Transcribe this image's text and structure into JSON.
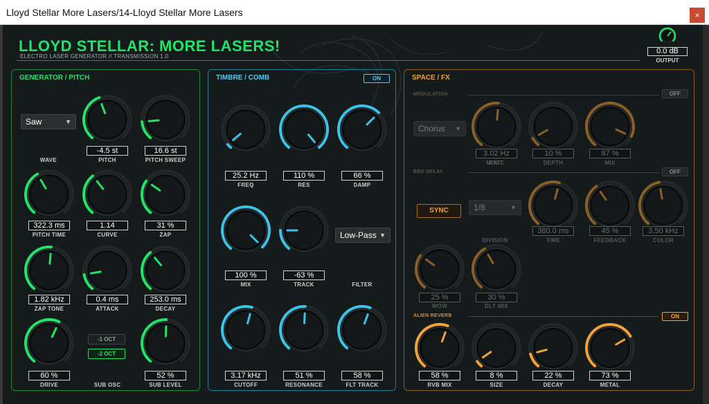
{
  "window": {
    "title": "Lloyd Stellar More Lasers/14-Lloyd Stellar More Lasers",
    "close_label": "×"
  },
  "header": {
    "title": "LLOYD STELLAR: MORE LASERS!",
    "subtitle": "ELECTRO LASER GENERATOR  //  TRANSMISSION 1.0",
    "output": {
      "value": "0.0 dB",
      "label": "OUTPUT"
    }
  },
  "colors": {
    "green": "#22e36a",
    "blue": "#3cc2e8",
    "orange": "#f0a236"
  },
  "generator": {
    "title": "GENERATOR / PITCH",
    "wave": {
      "selected": "Saw",
      "label": "WAVE"
    },
    "pitch": {
      "value": "-4.5 st",
      "label": "PITCH"
    },
    "pitch_sweep": {
      "value": "16.6 st",
      "label": "PITCH SWEEP"
    },
    "pitch_time": {
      "value": "322.3 ms",
      "label": "PITCH TIME"
    },
    "curve": {
      "value": "1.14",
      "label": "CURVE"
    },
    "zap": {
      "value": "31 %",
      "label": "ZAP"
    },
    "zap_tone": {
      "value": "1.82 kHz",
      "label": "ZAP TONE"
    },
    "attack": {
      "value": "0.4 ms",
      "label": "ATTACK"
    },
    "decay": {
      "value": "253.0 ms",
      "label": "DECAY"
    },
    "drive": {
      "value": "60 %",
      "label": "DRIVE"
    },
    "sub_osc": {
      "label": "SUB OSC",
      "options": [
        "-1 OCT",
        "-2 OCT"
      ],
      "selected": "-2 OCT"
    },
    "sub_level": {
      "value": "52 %",
      "label": "SUB LEVEL"
    }
  },
  "timbre": {
    "title": "TIMBRE / COMB",
    "toggle": "ON",
    "freq": {
      "value": "25.2 Hz",
      "label": "FREQ"
    },
    "res": {
      "value": "110 %",
      "label": "RES"
    },
    "damp": {
      "value": "66 %",
      "label": "DAMP"
    },
    "mix": {
      "value": "100 %",
      "label": "MIX"
    },
    "track": {
      "value": "-63 %",
      "label": "TRACK"
    },
    "filter": {
      "selected": "Low-Pass",
      "label": "FILTER"
    },
    "cutoff": {
      "value": "3.17 kHz",
      "label": "CUTOFF"
    },
    "resonance": {
      "value": "51 %",
      "label": "RESONANCE"
    },
    "flt_track": {
      "value": "58 %",
      "label": "FLT TRACK"
    }
  },
  "space": {
    "title": "SPACE / FX",
    "modulation": {
      "title": "MODULATION",
      "toggle": "OFF",
      "mod_select": "Chorus",
      "mod_label": "MOD",
      "rate": {
        "value": "3.02 Hz",
        "label": "RATE"
      },
      "depth": {
        "value": "10 %",
        "label": "DEPTH"
      },
      "mix": {
        "value": "87 %",
        "label": "MIX"
      }
    },
    "bbd": {
      "title": "BBD DELAY",
      "toggle": "OFF",
      "sync": "SYNC",
      "division": {
        "selected": "1/8",
        "label": "DIVISION"
      },
      "time": {
        "value": "380.0 ms",
        "label": "TIME"
      },
      "feedback": {
        "value": "45 %",
        "label": "FEEDBACK"
      },
      "color": {
        "value": "3.50 kHz",
        "label": "COLOR"
      },
      "wow": {
        "value": "25 %",
        "label": "WOW"
      },
      "dly_mix": {
        "value": "30 %",
        "label": "DLY MIX"
      }
    },
    "reverb": {
      "title": "ALIEN REVERB",
      "toggle": "ON",
      "rvb_mix": {
        "value": "58 %",
        "label": "RVB MIX"
      },
      "size": {
        "value": "8 %",
        "label": "SIZE"
      },
      "decay": {
        "value": "22 %",
        "label": "DECAY"
      },
      "metal": {
        "value": "73 %",
        "label": "METAL"
      }
    }
  }
}
